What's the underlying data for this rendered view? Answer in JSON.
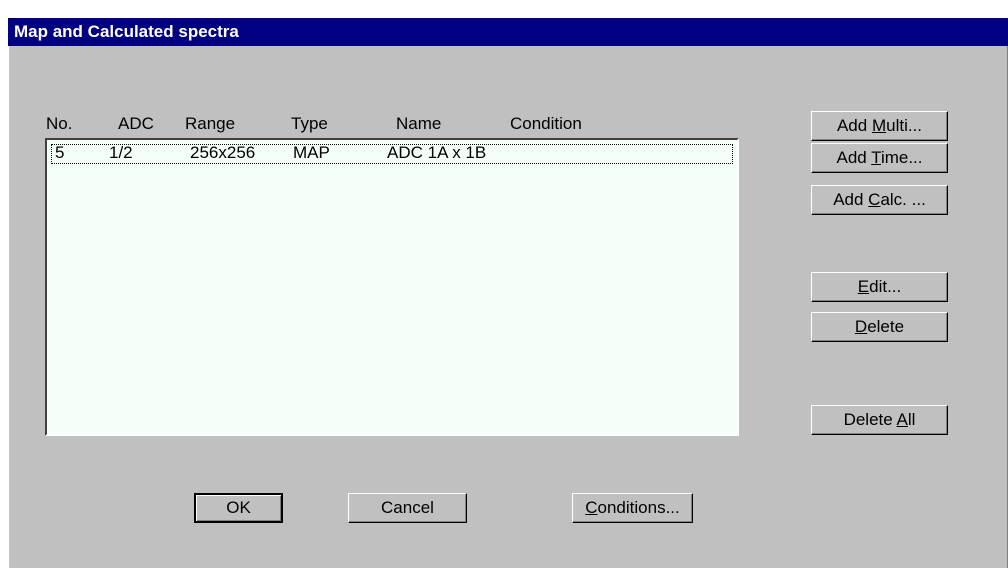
{
  "window": {
    "title": "Map and Calculated spectra"
  },
  "columns": [
    "No.",
    "ADC",
    "Range",
    "Type",
    "Name",
    "Condition"
  ],
  "rows": [
    {
      "no": "5",
      "adc": "1/2",
      "range": "256x256",
      "type": "MAP",
      "name": "ADC 1A x 1B",
      "condition": ""
    }
  ],
  "side_buttons": {
    "add_multi": {
      "pre": "Add ",
      "key": "M",
      "post": "ulti..."
    },
    "add_time": {
      "pre": "Add ",
      "key": "T",
      "post": "ime..."
    },
    "add_calc": {
      "pre": "Add ",
      "key": "C",
      "post": "alc. ..."
    },
    "edit": {
      "pre": "",
      "key": "E",
      "post": "dit..."
    },
    "delete": {
      "pre": "",
      "key": "D",
      "post": "elete"
    },
    "delete_all": {
      "pre": "Delete ",
      "key": "A",
      "post": "ll"
    }
  },
  "bottom_buttons": {
    "ok": "OK",
    "cancel": "Cancel",
    "conditions": {
      "pre": "",
      "key": "C",
      "post": "onditions..."
    }
  },
  "colors": {
    "title_bar": "#000080",
    "dialog_face": "#c0c0c0",
    "list_background": "#f4fff8"
  }
}
